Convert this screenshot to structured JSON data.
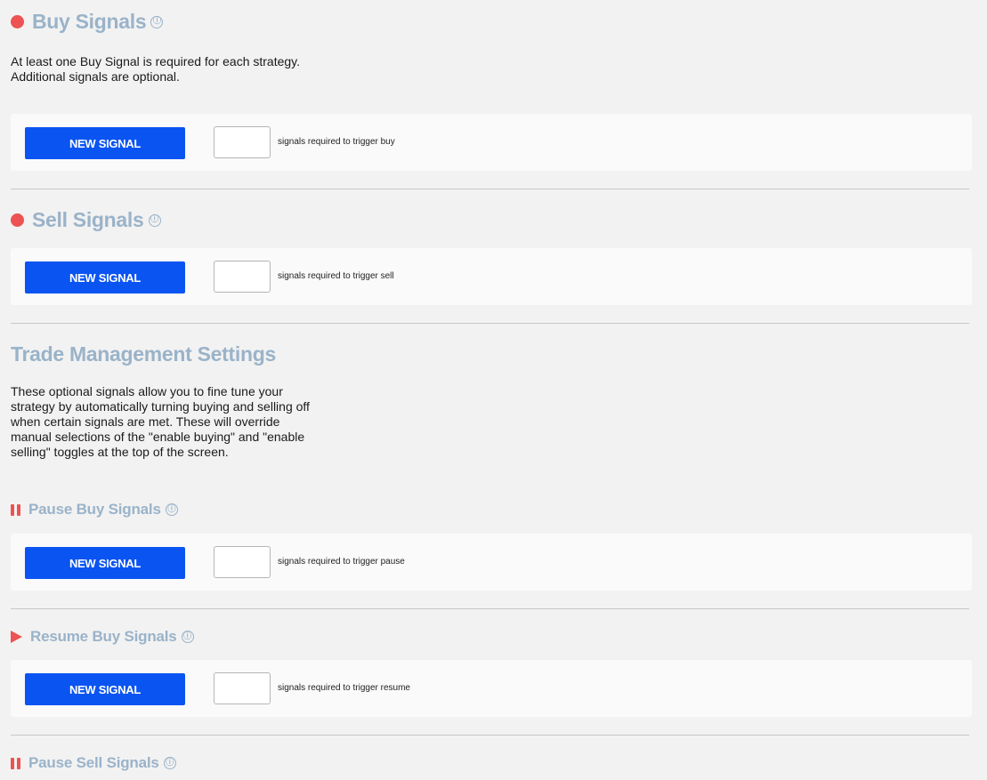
{
  "buy": {
    "title": "Buy Signals",
    "description": "At least one Buy Signal is required for each strategy.\nAdditional signals are optional.",
    "button": "NEW SIGNAL",
    "count_value": "",
    "count_label": "signals required to trigger buy"
  },
  "sell": {
    "title": "Sell Signals",
    "button": "NEW SIGNAL",
    "count_value": "",
    "count_label": "signals required to trigger sell"
  },
  "trade_management": {
    "title": "Trade Management Settings",
    "description": "These optional signals allow you to fine tune your\nstrategy by automatically turning buying and selling off\nwhen certain signals are met. These will override\nmanual selections of the \"enable buying\" and \"enable\nselling\" toggles at the top of the screen."
  },
  "pause_buy": {
    "title": "Pause Buy Signals",
    "button": "NEW SIGNAL",
    "count_value": "",
    "count_label": "signals required to trigger pause"
  },
  "resume_buy": {
    "title": "Resume Buy Signals",
    "button": "NEW SIGNAL",
    "count_value": "",
    "count_label": "signals required to trigger resume"
  },
  "pause_sell": {
    "title": "Pause Sell Signals"
  },
  "icons": {
    "info": "ⓘ",
    "status_dot": "circle-icon",
    "pause": "pause-icon",
    "play": "play-icon"
  },
  "colors": {
    "accent_red": "#ec5352",
    "title_blue": "#9ab3c9",
    "button_blue": "#0a54f2",
    "background": "#f2f2f2"
  }
}
